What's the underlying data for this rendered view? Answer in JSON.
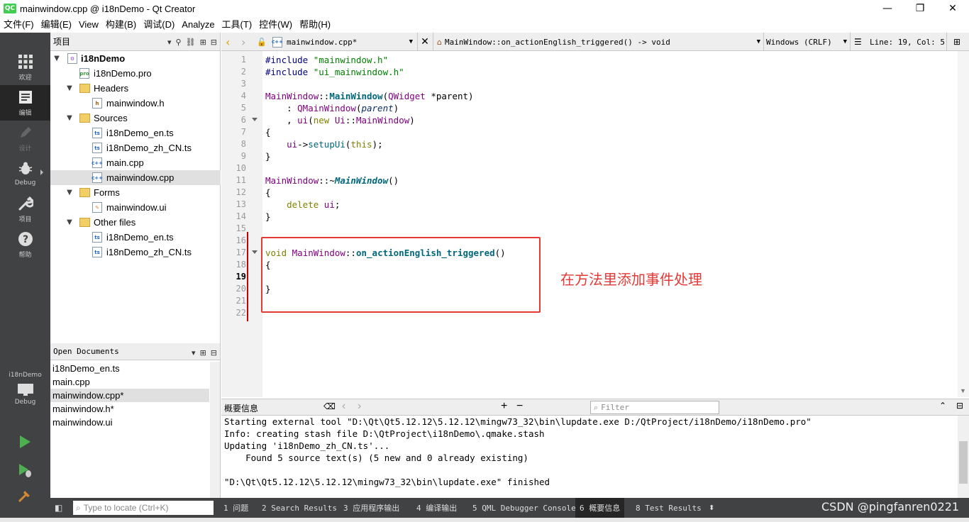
{
  "window": {
    "title": "mainwindow.cpp @ i18nDemo - Qt Creator",
    "logo": "QC",
    "minimize_glyph": "—",
    "maximize_glyph": "❐",
    "close_glyph": "✕"
  },
  "menu": [
    "文件(F)",
    "编辑(E)",
    "View",
    "构建(B)",
    "调试(D)",
    "Analyze",
    "工具(T)",
    "控件(W)",
    "帮助(H)"
  ],
  "modes": [
    {
      "label": "欢迎",
      "icon": "grid-icon"
    },
    {
      "label": "编辑",
      "icon": "edit-document-icon"
    },
    {
      "label": "设计",
      "icon": "pencil-icon"
    },
    {
      "label": "Debug",
      "icon": "bug-icon"
    },
    {
      "label": "项目",
      "icon": "wrench-icon"
    },
    {
      "label": "帮助",
      "icon": "help-icon"
    }
  ],
  "kit": {
    "project": "i18nDemo",
    "config": "Debug"
  },
  "project_panel": {
    "title": "项目",
    "tree": [
      {
        "label": "i18nDemo"
      },
      {
        "label": "i18nDemo.pro"
      },
      {
        "label": "Headers"
      },
      {
        "label": "mainwindow.h"
      },
      {
        "label": "Sources"
      },
      {
        "label": "i18nDemo_en.ts"
      },
      {
        "label": "i18nDemo_zh_CN.ts"
      },
      {
        "label": "main.cpp"
      },
      {
        "label": "mainwindow.cpp"
      },
      {
        "label": "Forms"
      },
      {
        "label": "mainwindow.ui"
      },
      {
        "label": "Other files"
      },
      {
        "label": "i18nDemo_en.ts"
      },
      {
        "label": "i18nDemo_zh_CN.ts"
      }
    ]
  },
  "open_documents": {
    "title": "Open Documents",
    "items": [
      "i18nDemo_en.ts",
      "main.cpp",
      "mainwindow.cpp*",
      "mainwindow.h*",
      "mainwindow.ui"
    ]
  },
  "editor_toolbar": {
    "file": "mainwindow.cpp*",
    "symbol": "MainWindow::on_actionEnglish_triggered() -> void",
    "line_ending": "Windows (CRLF)",
    "position": "Line: 19, Col: 5"
  },
  "editor": {
    "current_line": 19,
    "line_numbers": [
      "1",
      "2",
      "3",
      "4",
      "5",
      "6",
      "7",
      "8",
      "9",
      "10",
      "11",
      "12",
      "13",
      "14",
      "15",
      "16",
      "17",
      "18",
      "19",
      "20",
      "21",
      "22"
    ]
  },
  "annotation": {
    "text": "在方法里添加事件处理",
    "color": "#e53935"
  },
  "output": {
    "title": "概要信息",
    "filter_placeholder": "Filter",
    "lines": [
      "Starting external tool \"D:\\Qt\\Qt5.12.12\\5.12.12\\mingw73_32\\bin\\lupdate.exe D:/QtProject/i18nDemo/i18nDemo.pro\"",
      "Info: creating stash file D:\\QtProject\\i18nDemo\\.qmake.stash",
      "Updating 'i18nDemo_zh_CN.ts'...",
      "    Found 5 source text(s) (5 new and 0 already existing)",
      "",
      "\"D:\\Qt\\Qt5.12.12\\5.12.12\\mingw73_32\\bin\\lupdate.exe\" finished"
    ]
  },
  "statusbar": {
    "locator_placeholder": "Type to locate (Ctrl+K)",
    "tabs": [
      "1 问题",
      "2 Search Results",
      "3 应用程序输出",
      "4 编译输出",
      "5 QML Debugger Console",
      "6 概要信息",
      "8 Test Results"
    ],
    "active_tab": 5
  },
  "watermark": "CSDN @pingfanren0221",
  "colors": {
    "modebar": "#404244",
    "keyword": "#808000",
    "string": "#008000",
    "function": "#00677c",
    "class": "#800080"
  }
}
